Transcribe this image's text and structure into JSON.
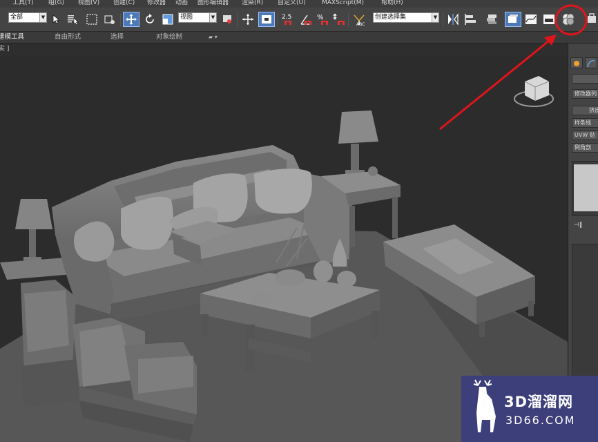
{
  "menu": {
    "items": [
      "工具(T)",
      "组(G)",
      "视图(V)",
      "创建(C)",
      "修改器",
      "动画",
      "图形编辑器",
      "渲染(R)",
      "自定义(U)",
      "MAXScript(M)",
      "帮助(H)"
    ]
  },
  "toolbar": {
    "selection_filter": "全部",
    "reference_coord": "视图",
    "named_selection_set": "创建选择集"
  },
  "ribbon": {
    "tabs": [
      "建模工具",
      "自由形式",
      "选择",
      "对象绘制"
    ]
  },
  "viewport": {
    "label": "实 ]"
  },
  "command_panel": {
    "modifier_list": "修改器列",
    "buttons": [
      "挤出",
      "样条线",
      "UVW 贴",
      "倒角剖"
    ]
  },
  "colors": {
    "annotation": "#e0141b",
    "watermark_bg": "#3c3f79"
  },
  "watermark": {
    "line1": "3D溜溜网",
    "line2": "3D66.COM"
  }
}
